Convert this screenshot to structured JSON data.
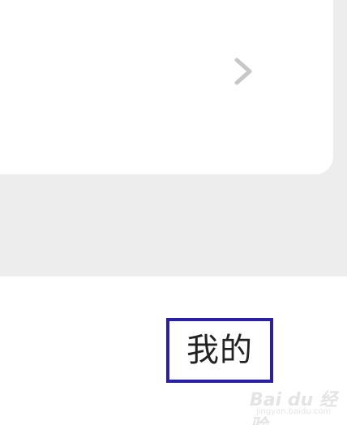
{
  "card": {
    "chevron_icon": "chevron-right-icon"
  },
  "tabbar": {
    "mine_label": "我的"
  },
  "watermark": {
    "logo": "Bai du 经验",
    "site": "jingyan.baidu.com"
  },
  "colors": {
    "background_gray": "#ededed",
    "card_white": "#ffffff",
    "highlight_border": "#2b1fa8",
    "chevron": "#c7c7c7",
    "text": "#222222"
  }
}
